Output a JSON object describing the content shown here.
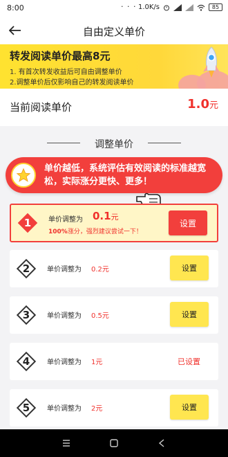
{
  "status_bar": {
    "time": "8:00",
    "dots": "· · ·",
    "speed": "1.0K/s",
    "battery": "85"
  },
  "nav": {
    "title": "自由定义单价"
  },
  "banner": {
    "title": "转发阅读单价最高8元",
    "line1": "1. 有首次转发收益后可自由调整单价",
    "line2": "2.调整单价后仅影响自己的转发阅读单价"
  },
  "current": {
    "label": "当前阅读单价",
    "value": "1.0",
    "unit": "元"
  },
  "section": {
    "title": "调整单价"
  },
  "promo": {
    "text": "单价越低，系统评估有效阅读的标准越宽松，实际涨分更快、更多！"
  },
  "options": [
    {
      "num": "1",
      "label": "单价调整为",
      "value": "0.1",
      "unit": "元",
      "sub_bold": "100%",
      "sub_rest": "涨分，强烈建议尝试一下！",
      "button": "设置"
    },
    {
      "num": "2",
      "label": "单价调整为",
      "value": "0.2元",
      "button": "设置"
    },
    {
      "num": "3",
      "label": "单价调整为",
      "value": "0.5元",
      "button": "设置"
    },
    {
      "num": "4",
      "label": "单价调整为",
      "value": "1元",
      "status": "已设置"
    },
    {
      "num": "5",
      "label": "单价调整为",
      "value": "2元",
      "button": "设置"
    }
  ],
  "colors": {
    "accent_red": "#f23f3c",
    "accent_yellow": "#ffe650",
    "banner_yellow": "#ffd83a"
  }
}
